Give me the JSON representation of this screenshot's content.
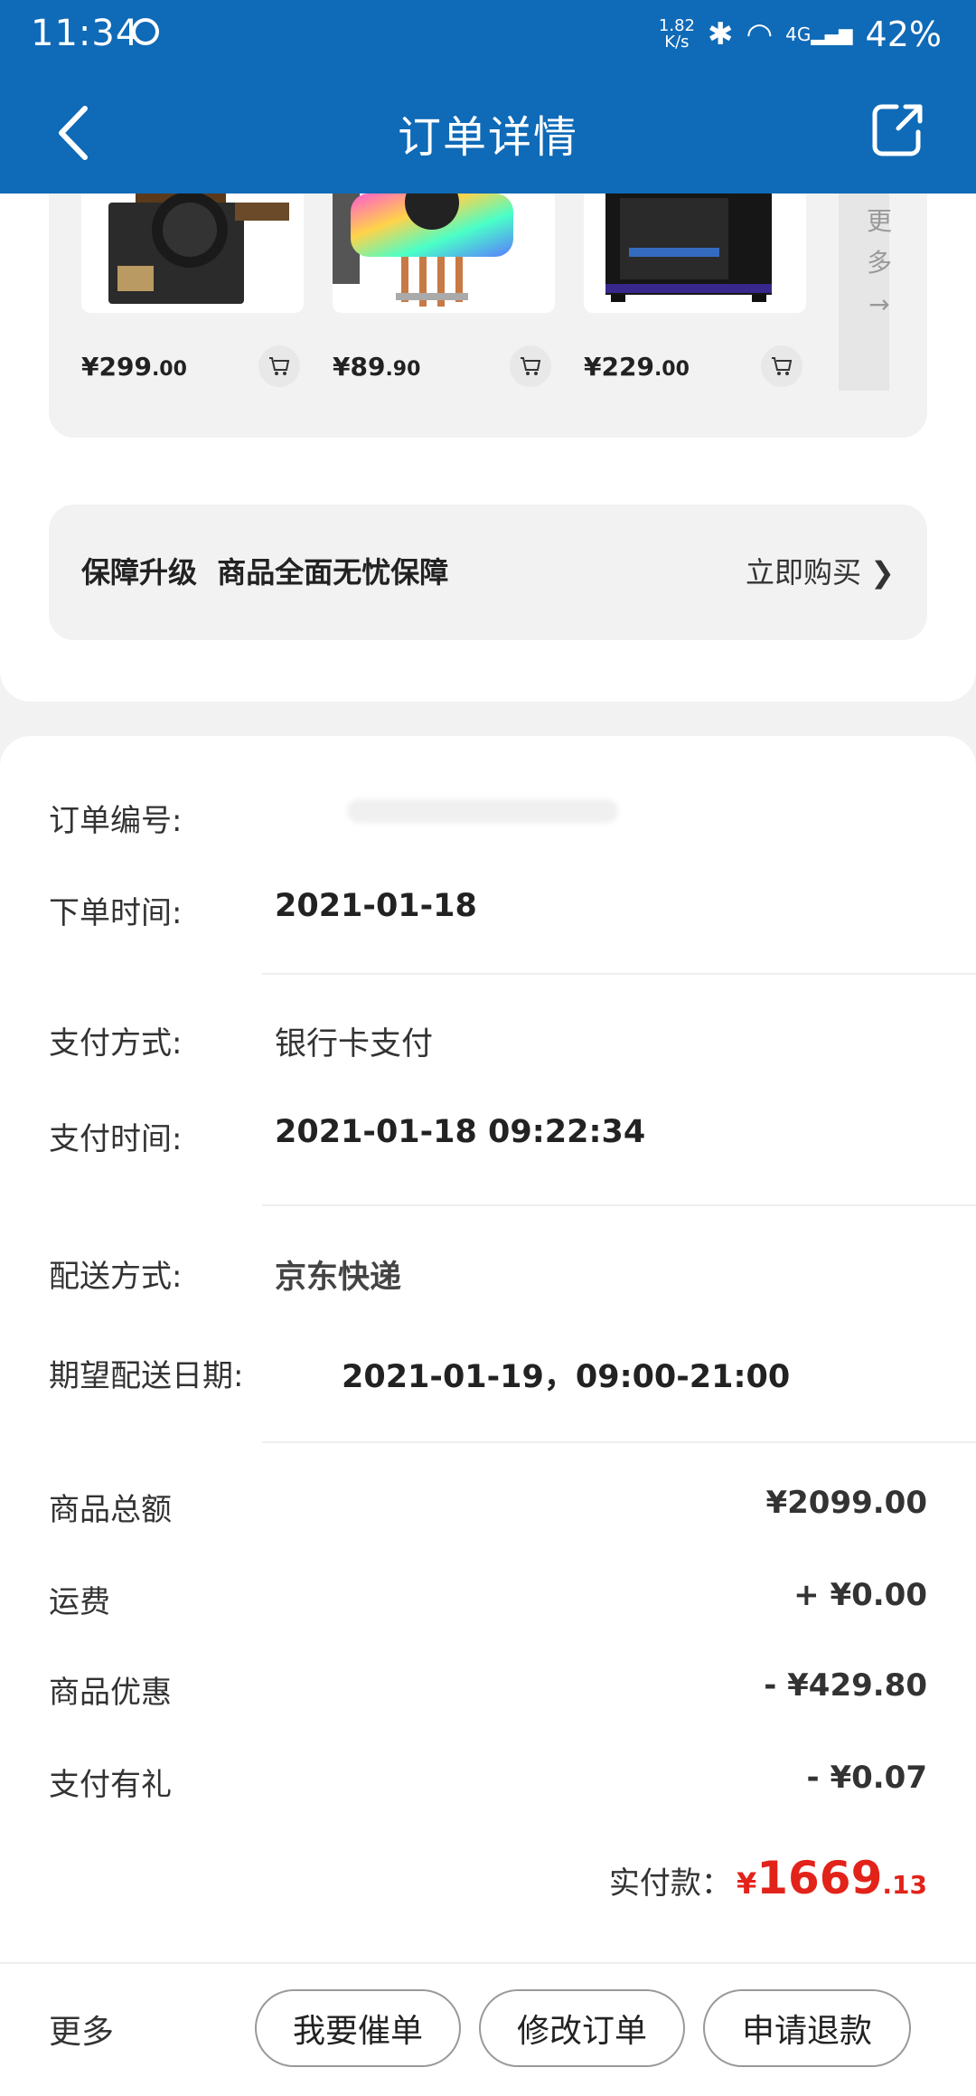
{
  "status_bar": {
    "time": "11:34",
    "speed_value": "1.82",
    "speed_unit": "K/s",
    "network": "4G",
    "battery": "42%"
  },
  "header": {
    "title": "订单详情",
    "back_icon": "chevron-left-icon",
    "share_icon": "share-icon"
  },
  "recommend": {
    "products": [
      {
        "price_int": "¥299",
        "price_dec": ".00"
      },
      {
        "price_int": "¥89",
        "price_dec": ".90"
      },
      {
        "price_int": "¥229",
        "price_dec": ".00"
      }
    ],
    "more_label": "更多"
  },
  "insurance": {
    "title": "保障升级  商品全面无忧保障",
    "action": "立即购买 ❯"
  },
  "order_info": {
    "order_no_label": "订单编号:",
    "order_time_label": "下单时间:",
    "order_time_value": "2021-01-18",
    "pay_method_label": "支付方式:",
    "pay_method_value": "银行卡支付",
    "pay_time_label": "支付时间:",
    "pay_time_value": "2021-01-18 09:22:34",
    "delivery_label": "配送方式:",
    "delivery_value": "京东快递",
    "expect_label": "期望配送日期:",
    "expect_value": "2021-01-19，09:00-21:00"
  },
  "fees": [
    {
      "label": "商品总额",
      "value": "¥2099.00"
    },
    {
      "label": "运费",
      "value": "+ ¥0.00"
    },
    {
      "label": "商品优惠",
      "value": "- ¥429.80"
    },
    {
      "label": "支付有礼",
      "value": "- ¥0.07"
    }
  ],
  "total": {
    "label": "实付款：",
    "currency": "¥",
    "integer": "1669",
    "decimal": ".13"
  },
  "bottom": {
    "more": "更多",
    "buttons": [
      "我要催单",
      "修改订单",
      "申请退款"
    ]
  },
  "colors": {
    "brand_blue": "#0f6ab7",
    "price_red": "#e2231a"
  }
}
